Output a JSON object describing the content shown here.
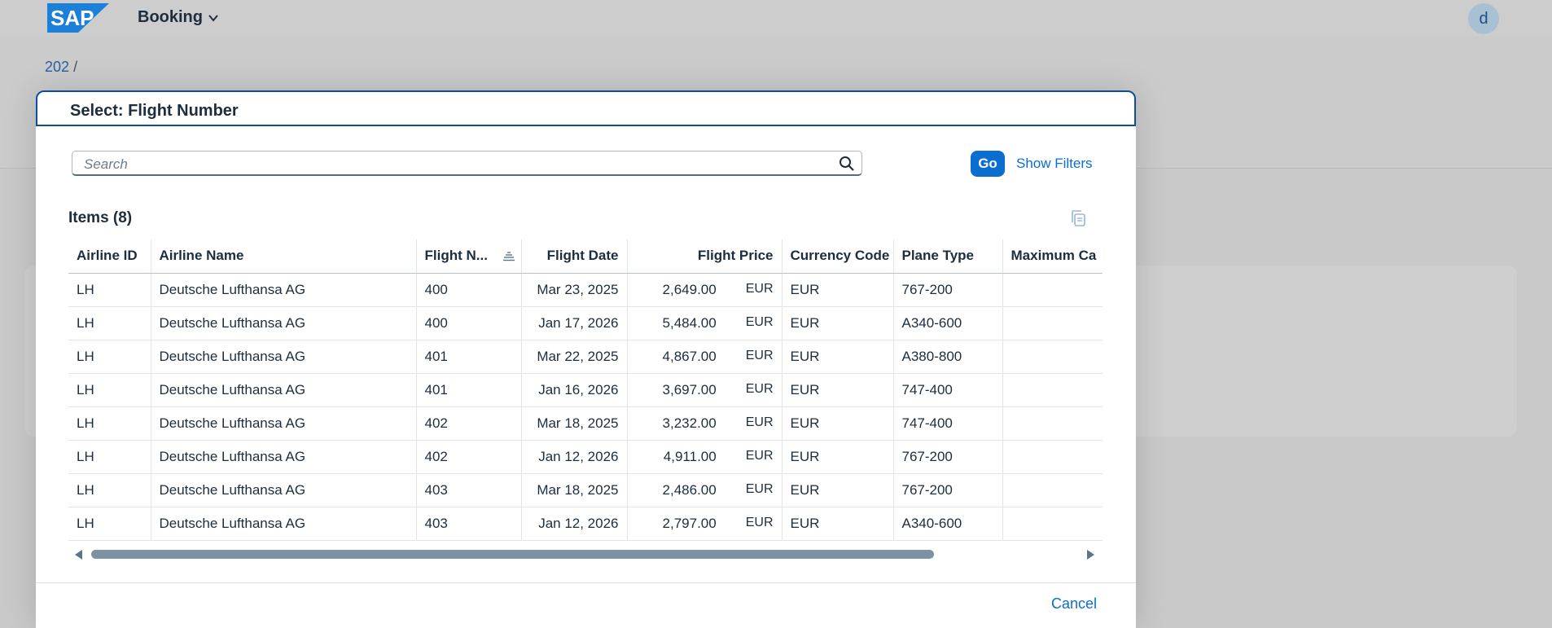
{
  "shell": {
    "app_title": "Booking",
    "avatar_initial": "d",
    "logo_text": "SAP",
    "colors": {
      "brand": "#0a6ed1",
      "logo": "#1e88e5"
    }
  },
  "breadcrumb": {
    "item": "202",
    "separator": "/"
  },
  "dialog": {
    "title": "Select: Flight Number",
    "search_placeholder": "Search",
    "go_label": "Go",
    "show_filters_label": "Show Filters",
    "items_title": "Items (8)",
    "cancel_label": "Cancel"
  },
  "table": {
    "columns": [
      "Airline ID",
      "Airline Name",
      "Flight N...",
      "Flight Date",
      "Flight Price",
      "Currency Code",
      "Plane Type",
      "Maximum Ca"
    ],
    "rows": [
      [
        "LH",
        "Deutsche Lufthansa AG",
        "400",
        "Mar 23, 2025",
        "2,649.00",
        "EUR",
        "EUR",
        "767-200"
      ],
      [
        "LH",
        "Deutsche Lufthansa AG",
        "400",
        "Jan 17, 2026",
        "5,484.00",
        "EUR",
        "EUR",
        "A340-600"
      ],
      [
        "LH",
        "Deutsche Lufthansa AG",
        "401",
        "Mar 22, 2025",
        "4,867.00",
        "EUR",
        "EUR",
        "A380-800"
      ],
      [
        "LH",
        "Deutsche Lufthansa AG",
        "401",
        "Jan 16, 2026",
        "3,697.00",
        "EUR",
        "EUR",
        "747-400"
      ],
      [
        "LH",
        "Deutsche Lufthansa AG",
        "402",
        "Mar 18, 2025",
        "3,232.00",
        "EUR",
        "EUR",
        "747-400"
      ],
      [
        "LH",
        "Deutsche Lufthansa AG",
        "402",
        "Jan 12, 2026",
        "4,911.00",
        "EUR",
        "EUR",
        "767-200"
      ],
      [
        "LH",
        "Deutsche Lufthansa AG",
        "403",
        "Mar 18, 2025",
        "2,486.00",
        "EUR",
        "EUR",
        "767-200"
      ],
      [
        "LH",
        "Deutsche Lufthansa AG",
        "403",
        "Jan 12, 2026",
        "2,797.00",
        "EUR",
        "EUR",
        "A340-600"
      ]
    ]
  }
}
